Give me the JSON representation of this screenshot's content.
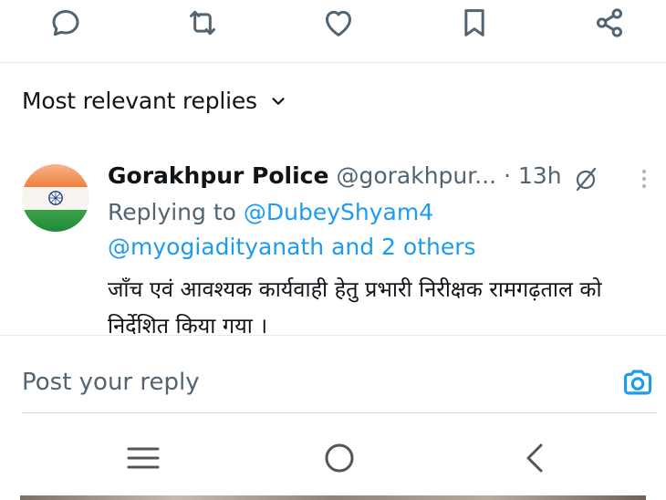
{
  "colors": {
    "icon": "#536471",
    "link": "#1d9bf0",
    "accent": "#1d9bf0",
    "text": "#0f1419"
  },
  "actions": [
    {
      "name": "reply-icon"
    },
    {
      "name": "repost-icon"
    },
    {
      "name": "like-icon"
    },
    {
      "name": "bookmark-icon"
    },
    {
      "name": "share-icon"
    }
  ],
  "sort": {
    "label": "Most relevant replies",
    "icon": "chevron-down-icon"
  },
  "reply": {
    "name": "Gorakhpur Police",
    "handle": "@gorakhpur...",
    "time": "· 13h",
    "replying_prefix": "Replying to ",
    "replying_to": "@DubeyShyam4",
    "mentions": "@myogiadityanath and 2 others",
    "text": "जाँच एवं आवश्यक कार्यवाही हेतु प्रभारी निरीक्षक रामगढ़ताल को निर्देशित किया गया ।"
  },
  "composer": {
    "placeholder": "Post your reply",
    "icon": "camera-icon"
  },
  "navbar": [
    {
      "name": "recent-apps-icon"
    },
    {
      "name": "home-icon"
    },
    {
      "name": "back-icon"
    }
  ]
}
